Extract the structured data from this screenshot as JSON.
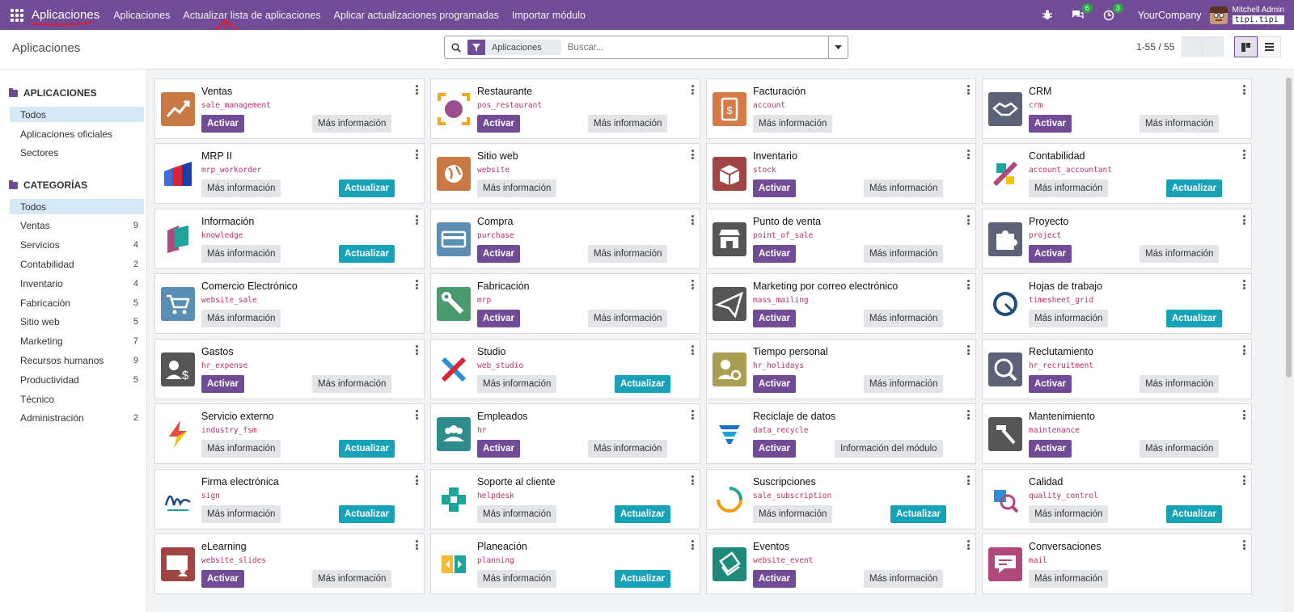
{
  "navbar": {
    "brand": "Aplicaciones",
    "menus": [
      "Aplicaciones",
      "Actualizar lista de aplicaciones",
      "Aplicar actualizaciones programadas",
      "Importar módulo"
    ],
    "messages_count": "6",
    "activities_count": "3",
    "company": "YourCompany",
    "user": "Mitchell Admin",
    "database": "tipi.tipi",
    "color": "#714b96"
  },
  "control_panel": {
    "title": "Aplicaciones",
    "facet": "Aplicaciones",
    "search_placeholder": "Buscar...",
    "pager": "1-55 / 55"
  },
  "sidebar": {
    "apps_title": "APLICACIONES",
    "apps_items": [
      {
        "label": "Todos",
        "active": true
      },
      {
        "label": "Aplicaciones oficiales"
      },
      {
        "label": "Sectores"
      }
    ],
    "categories_title": "CATEGORÍAS",
    "categories": [
      {
        "label": "Todos",
        "count": "",
        "active": true
      },
      {
        "label": "Ventas",
        "count": "9"
      },
      {
        "label": "Servicios",
        "count": "4"
      },
      {
        "label": "Contabilidad",
        "count": "2"
      },
      {
        "label": "Inventario",
        "count": "4"
      },
      {
        "label": "Fabricación",
        "count": "5"
      },
      {
        "label": "Sitio web",
        "count": "5"
      },
      {
        "label": "Marketing",
        "count": "7"
      },
      {
        "label": "Recursos humanos",
        "count": "9"
      },
      {
        "label": "Productividad",
        "count": "5"
      },
      {
        "label": "Técnico",
        "count": ""
      },
      {
        "label": "Administración",
        "count": "2"
      }
    ]
  },
  "labels": {
    "activate": "Activar",
    "upgrade": "Actualizar",
    "more_info": "Más información",
    "module_info": "Información del módulo"
  },
  "apps": [
    {
      "name": "Ventas",
      "tech": "sale_management",
      "state": "install",
      "icon": "chart-up-icon",
      "color": "#c97a44"
    },
    {
      "name": "Restaurante",
      "tech": "pos_restaurant",
      "state": "install",
      "icon": "restaurant-table-icon",
      "color": "#f5a623"
    },
    {
      "name": "Facturación",
      "tech": "account",
      "state": "info",
      "icon": "invoice-icon",
      "color": "#d67a48"
    },
    {
      "name": "CRM",
      "tech": "crm",
      "state": "install",
      "icon": "handshake-icon",
      "color": "#5b6278"
    },
    {
      "name": "MRP II",
      "tech": "mrp_workorder",
      "state": "upgrade",
      "icon": "mrp-bars-icon",
      "color": "#2f64d6"
    },
    {
      "name": "Sitio web",
      "tech": "website",
      "state": "info",
      "icon": "globe-icon",
      "color": "#c97a44"
    },
    {
      "name": "Inventario",
      "tech": "stock",
      "state": "install",
      "icon": "box-icon",
      "color": "#a04444"
    },
    {
      "name": "Contabilidad",
      "tech": "account_accountant",
      "state": "upgrade",
      "icon": "accounting-icon",
      "color": "#f1c40f"
    },
    {
      "name": "Información",
      "tech": "knowledge",
      "state": "upgrade",
      "icon": "knowledge-icon",
      "color": "#b0487b"
    },
    {
      "name": "Compra",
      "tech": "purchase",
      "state": "install",
      "icon": "credit-card-icon",
      "color": "#5a8fb3"
    },
    {
      "name": "Punto de venta",
      "tech": "point_of_sale",
      "state": "install",
      "icon": "store-icon",
      "color": "#555555"
    },
    {
      "name": "Proyecto",
      "tech": "project",
      "state": "install",
      "icon": "puzzle-icon",
      "color": "#5b6278"
    },
    {
      "name": "Comercio Electrónico",
      "tech": "website_sale",
      "state": "info",
      "icon": "cart-icon",
      "color": "#5a8fb3"
    },
    {
      "name": "Fabricación",
      "tech": "mrp",
      "state": "install",
      "icon": "wrench-icon",
      "color": "#4a9a6e"
    },
    {
      "name": "Marketing por correo electrónico",
      "tech": "mass_mailing",
      "state": "install",
      "icon": "paper-plane-icon",
      "color": "#555555"
    },
    {
      "name": "Hojas de trabajo",
      "tech": "timesheet_grid",
      "state": "upgrade",
      "icon": "timer-icon",
      "color": "#1f4e79"
    },
    {
      "name": "Gastos",
      "tech": "hr_expense",
      "state": "install",
      "icon": "expense-icon",
      "color": "#555555"
    },
    {
      "name": "Studio",
      "tech": "web_studio",
      "state": "upgrade",
      "icon": "studio-tools-icon",
      "color": "#2d8fd5"
    },
    {
      "name": "Tiempo personal",
      "tech": "hr_holidays",
      "state": "install",
      "icon": "time-off-icon",
      "color": "#a89f55"
    },
    {
      "name": "Reclutamiento",
      "tech": "hr_recruitment",
      "state": "install",
      "icon": "magnifier-person-icon",
      "color": "#5b6278"
    },
    {
      "name": "Servicio externo",
      "tech": "industry_fsm",
      "state": "upgrade",
      "icon": "bolt-icon",
      "color": "#e74c3c"
    },
    {
      "name": "Empleados",
      "tech": "hr",
      "state": "install",
      "icon": "people-icon",
      "color": "#2e8b8b"
    },
    {
      "name": "Reciclaje de datos",
      "tech": "data_recycle",
      "state": "install_module_info",
      "icon": "funnel-icon",
      "color": "#1a73c7"
    },
    {
      "name": "Mantenimiento",
      "tech": "maintenance",
      "state": "install",
      "icon": "hammer-icon",
      "color": "#555555"
    },
    {
      "name": "Firma electrónica",
      "tech": "sign",
      "state": "upgrade",
      "icon": "signature-icon",
      "color": "#1a4a7a"
    },
    {
      "name": "Soporte al cliente",
      "tech": "helpdesk",
      "state": "upgrade",
      "icon": "lifebuoy-icon",
      "color": "#1fa39a"
    },
    {
      "name": "Suscripciones",
      "tech": "sale_subscription",
      "state": "upgrade",
      "icon": "refresh-icon",
      "color": "#f39c12"
    },
    {
      "name": "Calidad",
      "tech": "quality_control",
      "state": "upgrade",
      "icon": "quality-icon",
      "color": "#2d8fd5"
    },
    {
      "name": "eLearning",
      "tech": "website_slides",
      "state": "install",
      "icon": "elearning-icon",
      "color": "#a04444"
    },
    {
      "name": "Planeación",
      "tech": "planning",
      "state": "upgrade",
      "icon": "planning-icon",
      "color": "#f5b93a"
    },
    {
      "name": "Eventos",
      "tech": "website_event",
      "state": "install",
      "icon": "ticket-icon",
      "color": "#1f8a7a"
    },
    {
      "name": "Conversaciones",
      "tech": "mail",
      "state": "info",
      "icon": "chat-icon",
      "color": "#b0487b"
    }
  ]
}
